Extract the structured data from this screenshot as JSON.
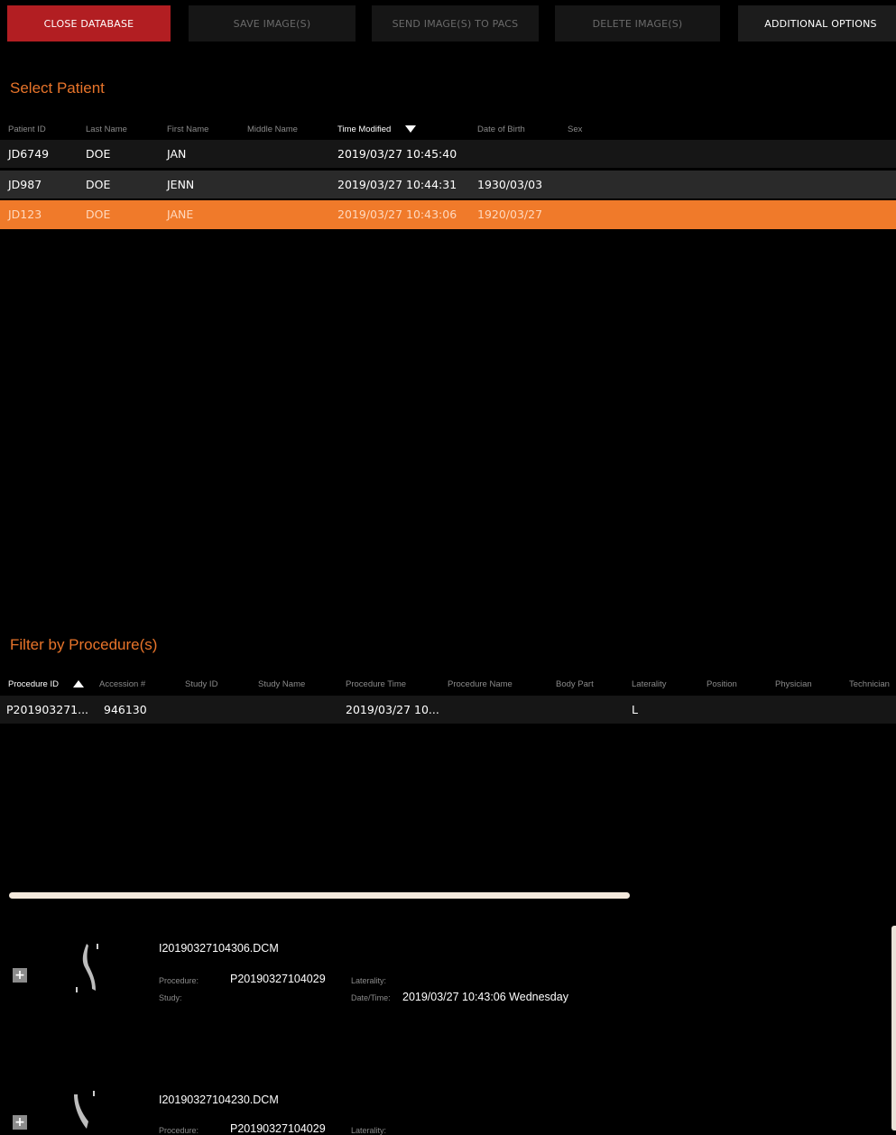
{
  "toolbar": {
    "close_database": "CLOSE DATABASE",
    "save_images": "SAVE IMAGE(S)",
    "send_images": "SEND IMAGE(S) TO PACS",
    "delete_images": "DELETE IMAGE(S)",
    "additional_options": "ADDITIONAL OPTIONS"
  },
  "patients": {
    "title": "Select Patient",
    "columns": [
      "Patient ID",
      "Last Name",
      "First Name",
      "Middle Name",
      "Time Modified",
      "Date of Birth",
      "Sex"
    ],
    "sorted_column": "Time Modified",
    "sort_direction": "descending",
    "rows": [
      {
        "id": "JD6749",
        "last": "DOE",
        "first": "JAN",
        "middle": "",
        "modified": "2019/03/27 10:45:40",
        "dob": "",
        "sex": ""
      },
      {
        "id": "JD987",
        "last": "DOE",
        "first": "JENN",
        "middle": "",
        "modified": "2019/03/27 10:44:31",
        "dob": "1930/03/03",
        "sex": ""
      },
      {
        "id": "JD123",
        "last": "DOE",
        "first": "JANE",
        "middle": "",
        "modified": "2019/03/27 10:43:06",
        "dob": "1920/03/27",
        "sex": ""
      }
    ],
    "selected_index": 2
  },
  "procedures": {
    "title": "Filter by Procedure(s)",
    "columns": [
      "Procedure ID",
      "Accession #",
      "Study ID",
      "Study Name",
      "Procedure Time",
      "Procedure Name",
      "Body Part",
      "Laterality",
      "Position",
      "Physician",
      "Technician"
    ],
    "sorted_column": "Procedure ID",
    "sort_direction": "ascending",
    "rows": [
      {
        "procedure_id": "P201903271...",
        "accession": "946130",
        "study_id": "",
        "study_name": "",
        "time": "2019/03/27 10...",
        "name": "",
        "body_part": "",
        "laterality": "L",
        "position": "",
        "physician": "",
        "technician": ""
      }
    ]
  },
  "images": [
    {
      "filename": "I20190327104306.DCM",
      "procedure_label": "Procedure:",
      "procedure": "P20190327104029",
      "study_label": "Study:",
      "study": "",
      "laterality_label": "Laterality:",
      "laterality": "",
      "datetime_label": "Date/Time:",
      "datetime": "2019/03/27 10:43:06 Wednesday"
    },
    {
      "filename": "I20190327104230.DCM",
      "procedure_label": "Procedure:",
      "procedure": "P20190327104029",
      "laterality_label": "Laterality:"
    }
  ],
  "colors": {
    "accent_orange": "#e8742a",
    "selected_row": "#f07a2a",
    "close_button_red": "#b21e22"
  },
  "icons": {
    "expand": "plus-icon",
    "sort_desc": "sort-down-icon",
    "sort_asc": "sort-up-icon"
  }
}
